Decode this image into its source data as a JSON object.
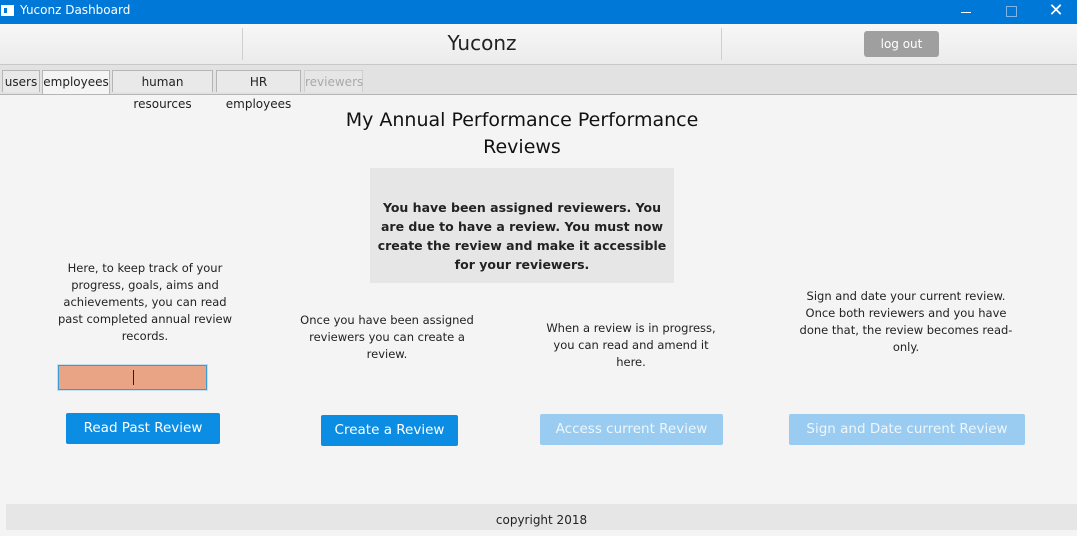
{
  "window": {
    "title": "Yuconz Dashboard",
    "close_glyph": "✕"
  },
  "header": {
    "brand": "Yuconz",
    "logout_label": "log out"
  },
  "tabs": [
    {
      "label": "users"
    },
    {
      "label": "employees"
    },
    {
      "label": "human resources"
    },
    {
      "label": "HR employees"
    },
    {
      "label": "reviewers"
    }
  ],
  "main": {
    "heading": "My Annual Performance Performance Reviews",
    "notice": "You have been assigned reviewers. You are due to have a review. You must now create the review and make it accessible for your reviewers.",
    "columns": [
      {
        "description": "Here, to keep track of your progress, goals, aims and achievements, you can read past completed annual review records.",
        "button": "Read Past Review"
      },
      {
        "description": "Once you have been assigned reviewers you can create a review.",
        "button": "Create a Review"
      },
      {
        "description": "When a review is in progress, you can read and amend it here.",
        "button": "Access current Review"
      },
      {
        "description": "Sign and date your current review. Once both reviewers and you have done that, the review becomes read-only.",
        "button": "Sign and Date current Review"
      }
    ],
    "review_input_value": ""
  },
  "footer": {
    "copyright": "copyright 2018"
  },
  "colors": {
    "titlebar": "#0078d7",
    "primary_button": "#0b8de4",
    "disabled_button": "#99ccf0",
    "input_highlight": "#e9a486"
  }
}
